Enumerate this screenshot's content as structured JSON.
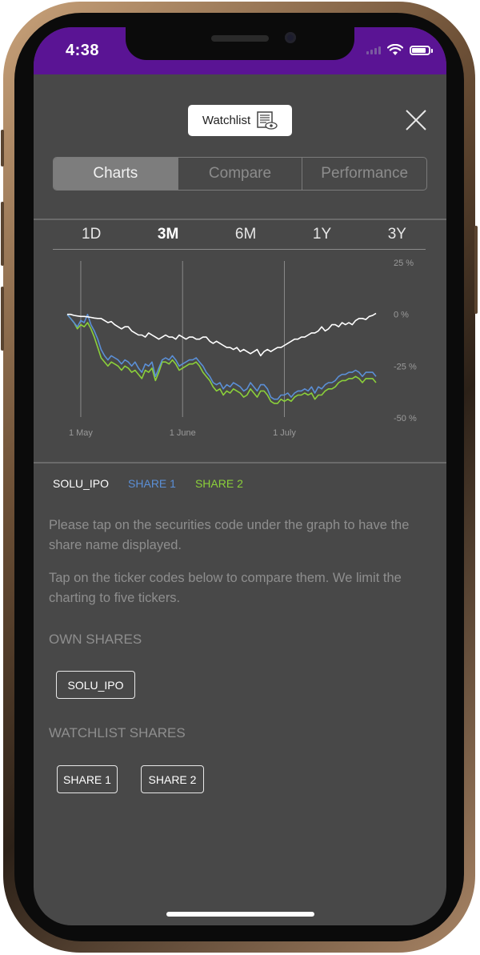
{
  "status_bar": {
    "time": "4:38"
  },
  "header": {
    "watchlist_label": "Watchlist"
  },
  "tabs": [
    {
      "label": "Charts",
      "active": true
    },
    {
      "label": "Compare",
      "active": false
    },
    {
      "label": "Performance",
      "active": false
    }
  ],
  "ranges": [
    {
      "label": "1D",
      "active": false
    },
    {
      "label": "3M",
      "active": true
    },
    {
      "label": "6M",
      "active": false
    },
    {
      "label": "1Y",
      "active": false
    },
    {
      "label": "3Y",
      "active": false
    }
  ],
  "chart_data": {
    "type": "line",
    "ylim": [
      -50,
      25
    ],
    "y_ticks": [
      "25 %",
      "0 %",
      "-25 %",
      "-50 %"
    ],
    "x_tick_labels": [
      "1 May",
      "1 June",
      "1 July"
    ],
    "x_tick_index": [
      4,
      34,
      64
    ],
    "series": [
      {
        "name": "SOLU_IPO",
        "color": "#ffffff",
        "values": [
          0,
          0,
          -0.5,
          -0.8,
          -1,
          -1,
          -1.2,
          -1.5,
          -1.8,
          -2,
          -2,
          -3,
          -4,
          -3.5,
          -5,
          -6,
          -7,
          -6,
          -6,
          -8,
          -9,
          -10,
          -10,
          -11,
          -9,
          -10,
          -11,
          -12,
          -11,
          -10,
          -11,
          -11,
          -12,
          -10,
          -11,
          -12,
          -11,
          -11,
          -12,
          -12,
          -11,
          -11,
          -13,
          -14,
          -13,
          -14,
          -15,
          -16,
          -16,
          -17,
          -16,
          -18,
          -17,
          -18,
          -19,
          -18,
          -17,
          -20,
          -18,
          -17,
          -18,
          -17,
          -16,
          -16,
          -15,
          -14,
          -13,
          -12,
          -12,
          -11,
          -11,
          -10,
          -9,
          -9,
          -8,
          -6,
          -8,
          -7,
          -5,
          -5,
          -6,
          -4,
          -5,
          -4,
          -5,
          -3,
          -2,
          -2,
          -2.5,
          -1,
          -0.5,
          0.5
        ]
      },
      {
        "name": "SHARE 1",
        "color": "#5b8fd6",
        "values": [
          0,
          -2,
          -4,
          -6,
          -3,
          -4,
          0,
          -5,
          -8,
          -12,
          -17,
          -20,
          -22,
          -20,
          -21,
          -22,
          -24,
          -22,
          -23,
          -25,
          -23,
          -26,
          -28,
          -24,
          -25,
          -23,
          -30,
          -26,
          -22,
          -21,
          -22,
          -20,
          -22,
          -25,
          -24,
          -23,
          -22,
          -22,
          -21,
          -23,
          -25,
          -28,
          -30,
          -33,
          -34,
          -33,
          -36,
          -34,
          -35,
          -33,
          -34,
          -35,
          -37,
          -36,
          -33,
          -35,
          -37,
          -34,
          -34,
          -36,
          -40,
          -41,
          -41,
          -39,
          -39,
          -38,
          -40,
          -38,
          -37,
          -37,
          -36,
          -37,
          -35,
          -38,
          -35,
          -36,
          -34,
          -33,
          -33,
          -32,
          -30,
          -29,
          -29,
          -28,
          -28,
          -27,
          -28,
          -30,
          -28,
          -28,
          -28,
          -30
        ]
      },
      {
        "name": "SHARE 2",
        "color": "#8bd03a",
        "values": [
          0,
          -2,
          -4,
          -7,
          -5,
          -6,
          -4,
          -7,
          -11,
          -16,
          -21,
          -23,
          -25,
          -23,
          -24,
          -25,
          -27,
          -25,
          -26,
          -28,
          -27,
          -29,
          -31,
          -27,
          -28,
          -26,
          -32,
          -28,
          -23,
          -23,
          -24,
          -22,
          -24,
          -27,
          -26,
          -25,
          -24,
          -24,
          -23,
          -25,
          -28,
          -30,
          -32,
          -35,
          -37,
          -36,
          -39,
          -37,
          -38,
          -36,
          -37,
          -38,
          -40,
          -39,
          -36,
          -38,
          -40,
          -37,
          -37,
          -39,
          -42,
          -43,
          -43,
          -41,
          -42,
          -41,
          -42,
          -40,
          -39,
          -39,
          -38,
          -39,
          -38,
          -41,
          -39,
          -39,
          -37,
          -36,
          -36,
          -35,
          -33,
          -32,
          -32,
          -31,
          -31,
          -30,
          -31,
          -33,
          -31,
          -31,
          -31,
          -33
        ]
      }
    ]
  },
  "legend": [
    "SOLU_IPO",
    "SHARE 1",
    "SHARE 2"
  ],
  "info": {
    "p1": "Please tap on the securities code under the graph to have the share name displayed.",
    "p2": "Tap on the ticker codes below to compare them. We limit the charting to five tickers."
  },
  "own_shares": {
    "title": "OWN SHARES",
    "items": [
      "SOLU_IPO"
    ]
  },
  "watchlist_shares": {
    "title": "WATCHLIST SHARES",
    "items": [
      "SHARE 1",
      "SHARE 2"
    ]
  },
  "colors": {
    "statusbar": "#5a1494",
    "background": "#484848",
    "share1": "#5b8fd6",
    "share2": "#8bd03a"
  }
}
